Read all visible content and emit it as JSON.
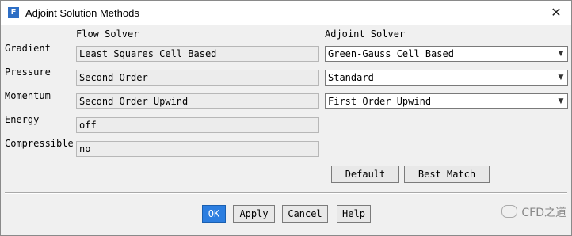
{
  "window": {
    "title": "Adjoint Solution Methods"
  },
  "columns": {
    "flow_solver": "Flow Solver",
    "adjoint_solver": "Adjoint Solver"
  },
  "rows": [
    {
      "label": "Gradient",
      "flow_value": "Least Squares Cell Based",
      "adjoint_value": "Green-Gauss Cell Based"
    },
    {
      "label": "Pressure",
      "flow_value": "Second Order",
      "adjoint_value": "Standard"
    },
    {
      "label": "Momentum",
      "flow_value": "Second Order Upwind",
      "adjoint_value": "First Order Upwind"
    },
    {
      "label": "Energy",
      "flow_value": "off"
    },
    {
      "label": "Compressible",
      "flow_value": "no"
    }
  ],
  "buttons": {
    "default": "Default",
    "best_match": "Best Match",
    "ok": "OK",
    "apply": "Apply",
    "cancel": "Cancel",
    "help": "Help"
  },
  "icons": {
    "app": "fluent-app-icon",
    "close": "close-icon",
    "dropdown": "chevron-down-icon"
  },
  "watermark": "CFD之道",
  "colors": {
    "ok_button": "#2c7ee0",
    "field_bg": "#ececec",
    "window_bg": "#f0f0f0"
  }
}
